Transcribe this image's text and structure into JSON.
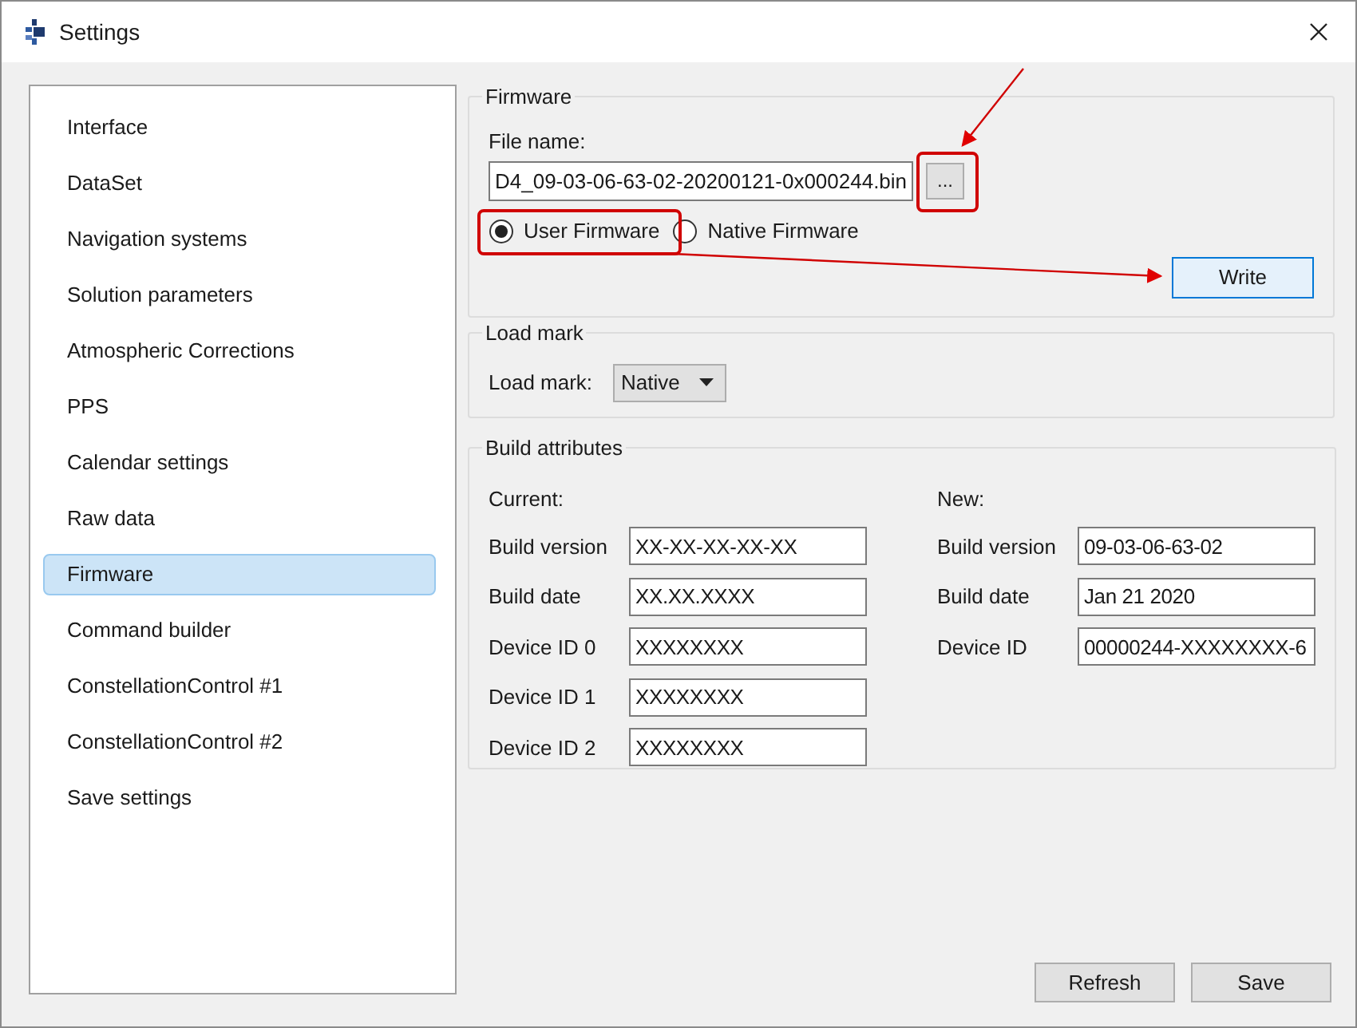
{
  "window": {
    "title": "Settings"
  },
  "sidebar": {
    "items": [
      {
        "label": "Interface",
        "selected": false
      },
      {
        "label": "DataSet",
        "selected": false
      },
      {
        "label": "Navigation systems",
        "selected": false
      },
      {
        "label": "Solution parameters",
        "selected": false
      },
      {
        "label": "Atmospheric Corrections",
        "selected": false
      },
      {
        "label": "PPS",
        "selected": false
      },
      {
        "label": "Calendar settings",
        "selected": false
      },
      {
        "label": "Raw data",
        "selected": false
      },
      {
        "label": "Firmware",
        "selected": true
      },
      {
        "label": "Command builder",
        "selected": false
      },
      {
        "label": "ConstellationControl #1",
        "selected": false
      },
      {
        "label": "ConstellationControl #2",
        "selected": false
      },
      {
        "label": "Save settings",
        "selected": false
      }
    ]
  },
  "firmware": {
    "title": "Firmware",
    "file_label": "File name:",
    "file_value": "D4_09-03-06-63-02-20200121-0x000244.bin",
    "browse_button": "...",
    "radios": [
      {
        "label": "User Firmware",
        "selected": true
      },
      {
        "label": "Native Firmware",
        "selected": false
      }
    ],
    "write_button": "Write"
  },
  "load_mark": {
    "title": "Load mark",
    "label": "Load mark:",
    "value": "Native"
  },
  "build_attributes": {
    "title": "Build attributes",
    "current": {
      "heading": "Current:",
      "fields": [
        {
          "label": "Build version",
          "value": "XX-XX-XX-XX-XX"
        },
        {
          "label": "Build date",
          "value": "XX.XX.XXXX"
        },
        {
          "label": "Device ID 0",
          "value": "XXXXXXXX"
        },
        {
          "label": "Device ID 1",
          "value": "XXXXXXXX"
        },
        {
          "label": "Device ID 2",
          "value": "XXXXXXXX"
        }
      ]
    },
    "new": {
      "heading": "New:",
      "fields": [
        {
          "label": "Build version",
          "value": "09-03-06-63-02"
        },
        {
          "label": "Build date",
          "value": "Jan 21 2020"
        },
        {
          "label": "Device ID",
          "value": "00000244-XXXXXXXX-6"
        }
      ]
    }
  },
  "buttons": [
    "Refresh",
    "Save"
  ]
}
